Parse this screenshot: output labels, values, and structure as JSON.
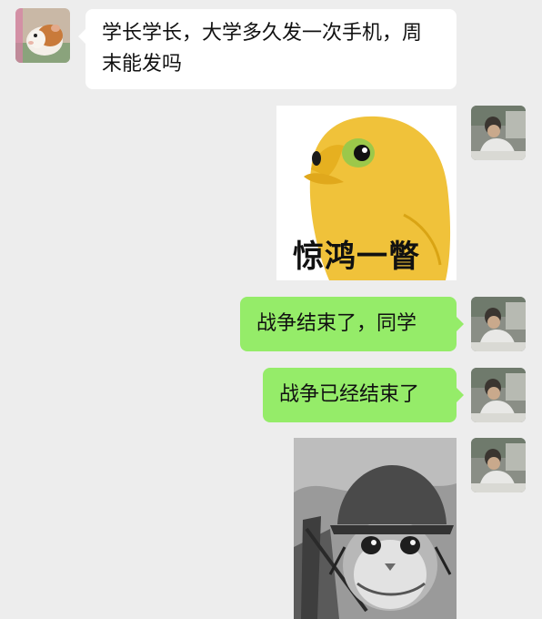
{
  "messages": [
    {
      "side": "in",
      "type": "text",
      "text": "学长学长，大学多久发一次手机，周末能发吗",
      "avatar": "guinea-pig-avatar"
    },
    {
      "side": "out",
      "type": "sticker",
      "sticker": "yellow-bird-sticker",
      "caption": "惊鸿一瞥",
      "avatar": "user-avatar"
    },
    {
      "side": "out",
      "type": "text",
      "text": "战争结束了，同学",
      "avatar": "user-avatar"
    },
    {
      "side": "out",
      "type": "text",
      "text": "战争已经结束了",
      "avatar": "user-avatar"
    },
    {
      "side": "out",
      "type": "sticker",
      "sticker": "soldier-cat-sticker",
      "avatar": "user-avatar"
    }
  ],
  "colors": {
    "background": "#ededed",
    "incoming_bubble": "#ffffff",
    "outgoing_bubble": "#95ec69"
  }
}
